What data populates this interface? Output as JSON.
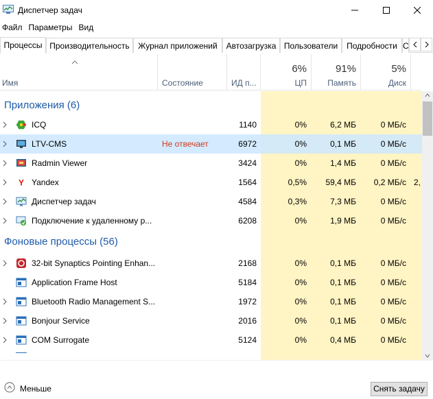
{
  "window": {
    "title": "Диспетчер задач"
  },
  "menu": [
    "Файл",
    "Параметры",
    "Вид"
  ],
  "tabs": [
    "Процессы",
    "Производительность",
    "Журнал приложений",
    "Автозагрузка",
    "Пользователи",
    "Подробности",
    "С"
  ],
  "columns": {
    "name": "Имя",
    "status": "Состояние",
    "pid": "ИД п...",
    "cpu": {
      "pct": "6%",
      "label": "ЦП"
    },
    "mem": {
      "pct": "91%",
      "label": "Память"
    },
    "disk": {
      "pct": "5%",
      "label": "Диск"
    }
  },
  "groups": {
    "apps": "Приложения (6)",
    "background": "Фоновые процессы (56)"
  },
  "apps": [
    {
      "name": "ICQ",
      "status": "",
      "pid": "1140",
      "cpu": "0%",
      "mem": "6,2 МБ",
      "disk": "0 МБ/с",
      "net": "",
      "icon": "icq-flower-icon"
    },
    {
      "name": "LTV-CMS",
      "status": "Не отвечает",
      "pid": "6972",
      "cpu": "0%",
      "mem": "0,1 МБ",
      "disk": "0 МБ/с",
      "net": "",
      "icon": "ltv-cms-icon"
    },
    {
      "name": "Radmin Viewer",
      "status": "",
      "pid": "3424",
      "cpu": "0%",
      "mem": "1,4 МБ",
      "disk": "0 МБ/с",
      "net": "",
      "icon": "radmin-icon"
    },
    {
      "name": "Yandex",
      "status": "",
      "pid": "1564",
      "cpu": "0,5%",
      "mem": "59,4 МБ",
      "disk": "0,2 МБ/с",
      "net": "2,",
      "icon": "yandex-icon"
    },
    {
      "name": "Диспетчер задач",
      "status": "",
      "pid": "4584",
      "cpu": "0,3%",
      "mem": "7,3 МБ",
      "disk": "0 МБ/с",
      "net": "",
      "icon": "task-manager-icon"
    },
    {
      "name": "Подключение к удаленному р...",
      "status": "",
      "pid": "6208",
      "cpu": "0%",
      "mem": "1,9 МБ",
      "disk": "0 МБ/с",
      "net": "",
      "icon": "remote-desktop-icon"
    }
  ],
  "background": [
    {
      "name": "32-bit Synaptics Pointing Enhan...",
      "pid": "2168",
      "cpu": "0%",
      "mem": "0,1 МБ",
      "disk": "0 МБ/с",
      "icon": "synaptics-icon"
    },
    {
      "name": "Application Frame Host",
      "pid": "5184",
      "cpu": "0%",
      "mem": "0,1 МБ",
      "disk": "0 МБ/с",
      "icon": "app-window-icon"
    },
    {
      "name": "Bluetooth Radio Management S...",
      "pid": "1972",
      "cpu": "0%",
      "mem": "0,1 МБ",
      "disk": "0 МБ/с",
      "icon": "app-window-icon"
    },
    {
      "name": "Bonjour Service",
      "pid": "2016",
      "cpu": "0%",
      "mem": "0,1 МБ",
      "disk": "0 МБ/с",
      "icon": "app-window-icon"
    },
    {
      "name": "COM Surrogate",
      "pid": "5124",
      "cpu": "0%",
      "mem": "0,4 МБ",
      "disk": "0 МБ/с",
      "icon": "app-window-icon"
    }
  ],
  "footer": {
    "less": "Меньше",
    "end_task": "Снять задачу"
  },
  "colors": {
    "cpu_bg": "#fff4c4",
    "mem_bg": "#ffe8a6",
    "disk_bg": "#fff4c4",
    "selected": "#cce8ff",
    "group": "#1e5aa8",
    "not_responding": "#cc3a1c"
  }
}
